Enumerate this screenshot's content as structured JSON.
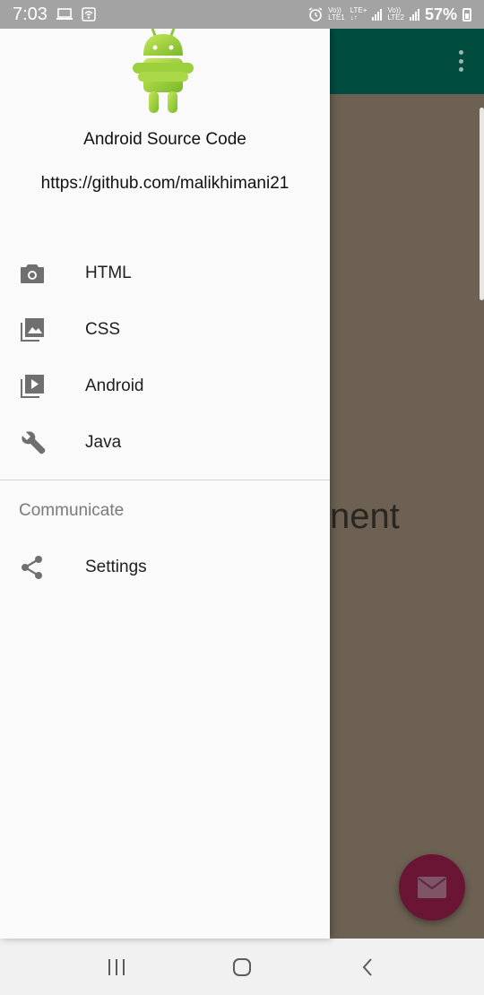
{
  "status_bar": {
    "time": "7:03",
    "volte1": "Vo))",
    "lte1": "LTE1",
    "lte_plus": "LTE+",
    "volte2": "Vo))",
    "lte2": "LTE2",
    "battery": "57%"
  },
  "drawer": {
    "header": {
      "title": "Android Source Code",
      "subtitle": "https://github.com/malikhimani21",
      "logo_icon": "android-robot-icon"
    },
    "items": [
      {
        "label": "HTML",
        "icon": "camera-icon"
      },
      {
        "label": "CSS",
        "icon": "photo-library-icon"
      },
      {
        "label": "Android",
        "icon": "video-library-icon"
      },
      {
        "label": "Java",
        "icon": "wrench-icon"
      }
    ],
    "section_title": "Communicate",
    "section_items": [
      {
        "label": "Settings",
        "icon": "share-icon"
      }
    ]
  },
  "background": {
    "partial_text": "nent",
    "fab_icon": "mail-icon"
  },
  "nav_bar": {
    "recents_icon": "recents-icon",
    "home_icon": "home-icon",
    "back_icon": "back-icon"
  },
  "colors": {
    "toolbar": "#004d40",
    "scrim": "#6c6153",
    "fab": "#6b1535",
    "drawer_bg": "#fafafa",
    "icon_gray": "#6f6f6f"
  }
}
